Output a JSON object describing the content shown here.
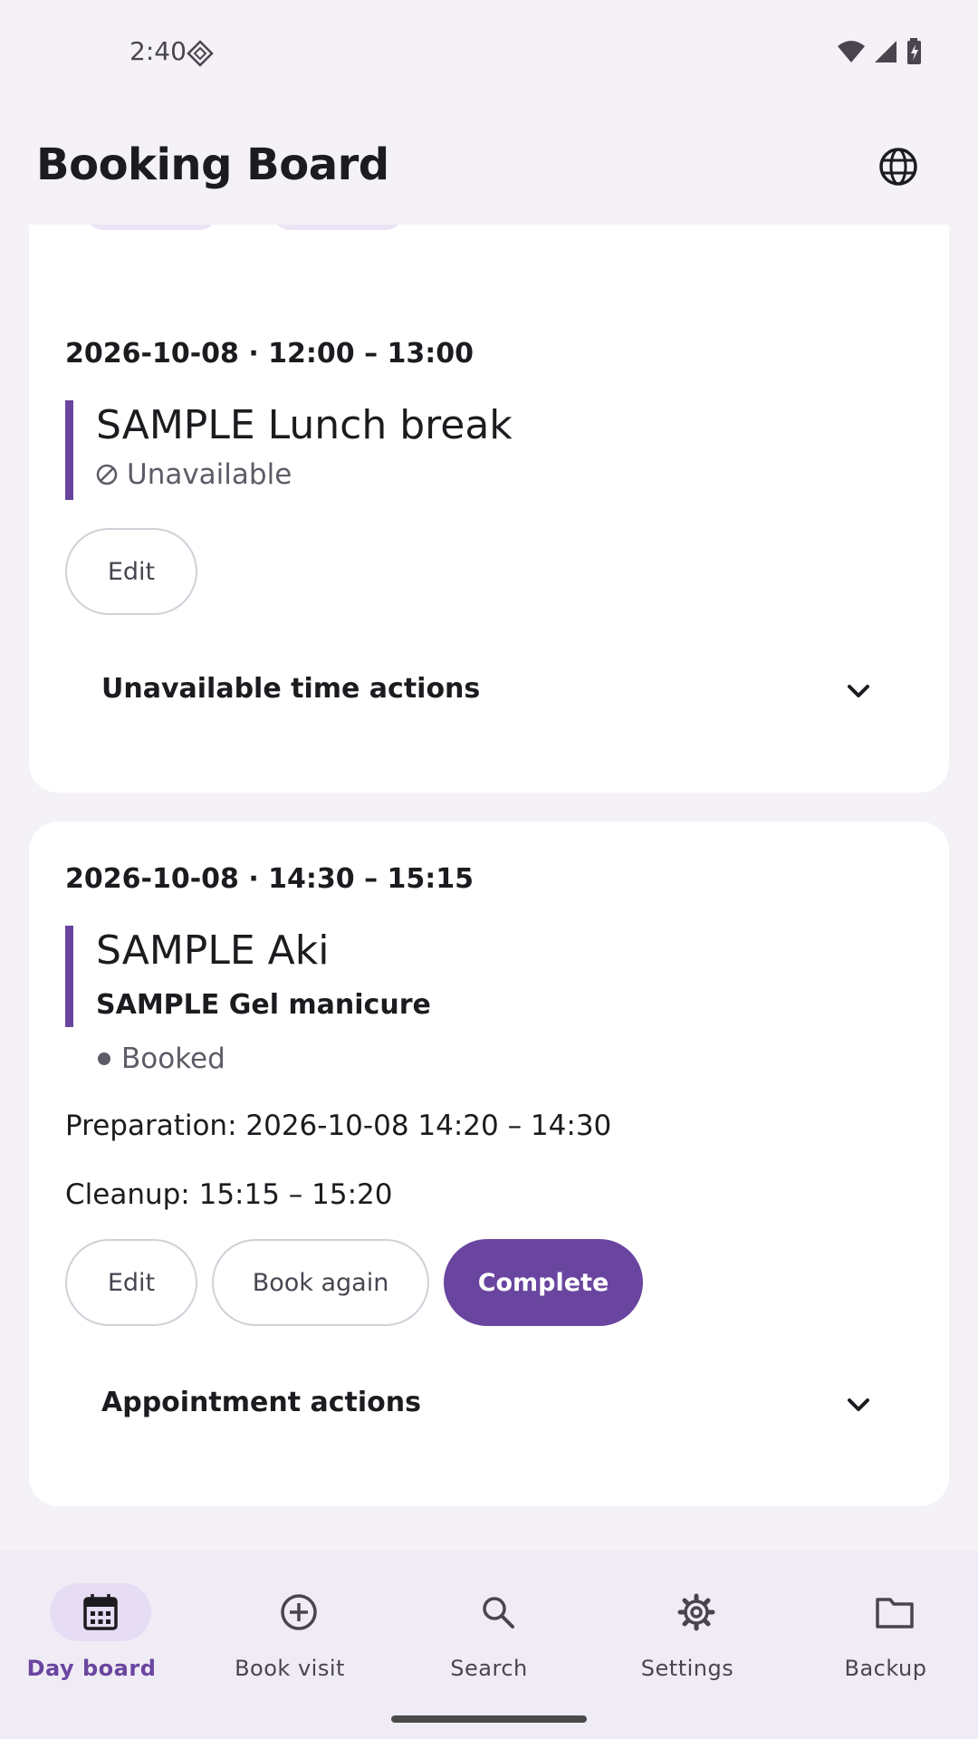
{
  "status_bar": {
    "time": "2:40",
    "icons": [
      "wifi-icon",
      "signal-icon",
      "battery-icon"
    ]
  },
  "app_bar": {
    "title": "Booking Board",
    "language_icon": "globe-icon"
  },
  "cards": [
    {
      "time": "2026-10-08 · 12:00 – 13:00",
      "title": "SAMPLE Lunch break",
      "status": "Unavailable",
      "status_icon": "blocked-icon",
      "buttons": {
        "edit": "Edit"
      },
      "expander": "Unavailable time actions"
    },
    {
      "time": "2026-10-08 · 14:30 – 15:15",
      "title": "SAMPLE Aki",
      "service": "SAMPLE Gel manicure",
      "status": "Booked",
      "preparation": "Preparation: 2026-10-08 14:20 – 14:30",
      "cleanup": "Cleanup: 15:15 – 15:20",
      "buttons": {
        "edit": "Edit",
        "book_again": "Book again",
        "complete": "Complete"
      },
      "expander": "Appointment actions"
    }
  ],
  "bottom_nav": {
    "items": [
      {
        "label": "Day board",
        "icon": "calendar-icon",
        "active": true
      },
      {
        "label": "Book visit",
        "icon": "add-circle-icon",
        "active": false
      },
      {
        "label": "Search",
        "icon": "search-icon",
        "active": false
      },
      {
        "label": "Settings",
        "icon": "gear-icon",
        "active": false
      },
      {
        "label": "Backup",
        "icon": "folder-icon",
        "active": false
      }
    ]
  },
  "colors": {
    "accent": "#6a45a0",
    "background": "#f4f1f7",
    "card": "#ffffff"
  }
}
